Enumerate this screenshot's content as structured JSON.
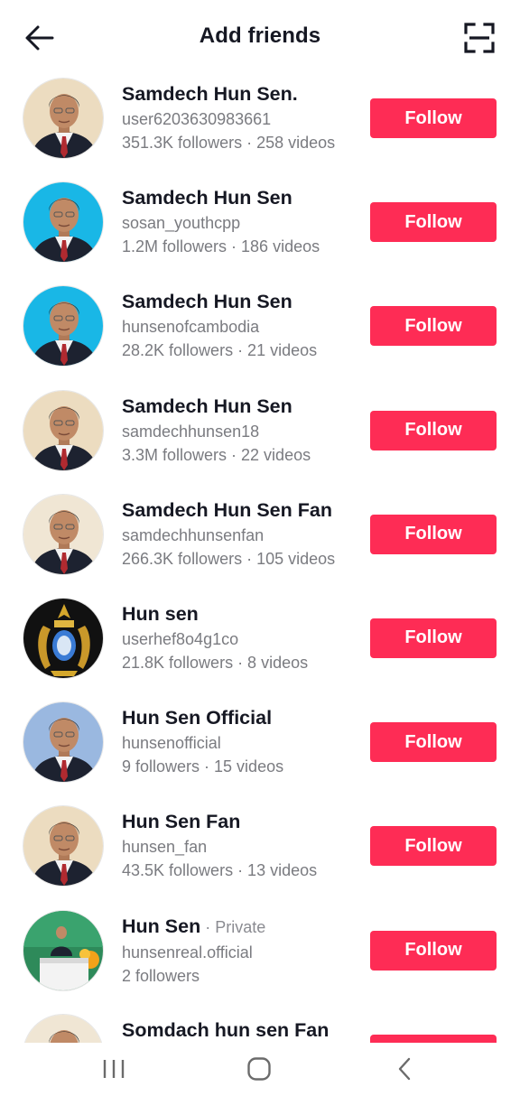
{
  "header": {
    "title": "Add friends",
    "back_icon": "arrow-left-icon",
    "scan_icon": "scan-qr-icon"
  },
  "accounts": [
    {
      "name": "Samdech Hun Sen.",
      "private_tag": "",
      "handle": "user6203630983661",
      "stats": "351.3K followers · 258 videos",
      "follow_label": "Follow",
      "avatar": "portrait",
      "avatar_bg": "#ecdcc0"
    },
    {
      "name": "Samdech Hun Sen",
      "private_tag": "",
      "handle": "sosan_youthcpp",
      "stats": "1.2M followers · 186 videos",
      "follow_label": "Follow",
      "avatar": "portrait",
      "avatar_bg": "#19b7e6"
    },
    {
      "name": "Samdech Hun Sen",
      "private_tag": "",
      "handle": "hunsenofcambodia",
      "stats": "28.2K followers · 21 videos",
      "follow_label": "Follow",
      "avatar": "portrait",
      "avatar_bg": "#19b7e6"
    },
    {
      "name": "Samdech Hun Sen",
      "private_tag": "",
      "handle": "samdechhunsen18",
      "stats": "3.3M followers · 22 videos",
      "follow_label": "Follow",
      "avatar": "portrait",
      "avatar_bg": "#ecdcc0"
    },
    {
      "name": "Samdech Hun Sen Fan",
      "private_tag": "",
      "handle": "samdechhunsenfan",
      "stats": "266.3K followers · 105 videos",
      "follow_label": "Follow",
      "avatar": "portrait",
      "avatar_bg": "#f0e6d4"
    },
    {
      "name": "Hun sen",
      "private_tag": "",
      "handle": "userhef8o4g1co",
      "stats": "21.8K followers · 8 videos",
      "follow_label": "Follow",
      "avatar": "emblem",
      "avatar_bg": "#111111"
    },
    {
      "name": "Hun Sen Official",
      "private_tag": "",
      "handle": "hunsenofficial",
      "stats": "9 followers · 15 videos",
      "follow_label": "Follow",
      "avatar": "portrait",
      "avatar_bg": "#9ab8e0"
    },
    {
      "name": "Hun Sen Fan",
      "private_tag": "",
      "handle": "hunsen_fan",
      "stats": "43.5K followers · 13 videos",
      "follow_label": "Follow",
      "avatar": "portrait",
      "avatar_bg": "#ecdcc0"
    },
    {
      "name": "Hun Sen",
      "private_tag": " · Private",
      "handle": "hunsenreal.official",
      "stats": "2 followers",
      "follow_label": "Follow",
      "avatar": "podium",
      "avatar_bg": "#2e8a5a"
    },
    {
      "name": "Somdach hun sen Fan",
      "private_tag": "",
      "handle": "",
      "stats": "",
      "follow_label": "Follow",
      "avatar": "portrait",
      "avatar_bg": "#f0e6d4"
    }
  ],
  "navbar": {
    "recents_icon": "recent-apps-icon",
    "home_icon": "home-icon",
    "back_icon": "nav-back-icon"
  },
  "colors": {
    "accent": "#fe2c55",
    "text_primary": "#161823",
    "text_secondary": "#7a7b80"
  }
}
